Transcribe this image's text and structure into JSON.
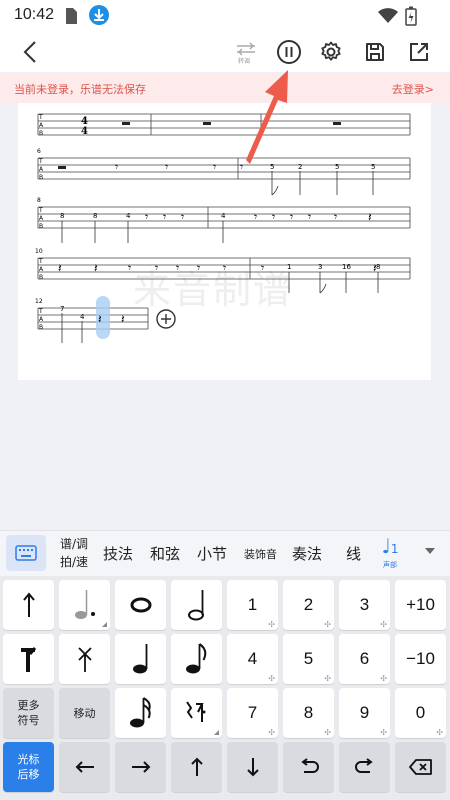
{
  "status": {
    "time": "10:42"
  },
  "toolbar": {
    "tune_label": "转调",
    "icons": [
      "back-icon",
      "tune-icon",
      "pause-icon",
      "settings-icon",
      "save-icon",
      "share-icon"
    ]
  },
  "banner": {
    "message": "当前未登录，乐谱无法保存",
    "login": "去登录>"
  },
  "score": {
    "watermark": "来音制谱",
    "systems": [
      {
        "measure_no": "",
        "frets": []
      },
      {
        "measure_no": "6",
        "frets": [
          "5",
          "2",
          "5",
          "5"
        ]
      },
      {
        "measure_no": "8",
        "frets": [
          "8",
          "8",
          "4",
          "4"
        ]
      },
      {
        "measure_no": "10",
        "frets": [
          "1",
          "3",
          "16",
          "8"
        ]
      },
      {
        "measure_no": "12",
        "frets": [
          "7",
          "4"
        ]
      }
    ],
    "time_signature": {
      "top": "4",
      "bottom": "4"
    },
    "tab_label": [
      "T",
      "A",
      "B"
    ]
  },
  "categories": {
    "stack_top": "谱/调",
    "stack_bottom": "拍/速",
    "items": [
      "技法",
      "和弦",
      "小节",
      "装饰音",
      "奏法",
      "线"
    ],
    "voice_label": "声部",
    "voice_number": "1"
  },
  "keypad": {
    "more_symbols": [
      "更多",
      "符号"
    ],
    "move": "移动",
    "cursor_back": [
      "光标",
      "后移"
    ],
    "numbers": [
      "1",
      "2",
      "3",
      "4",
      "5",
      "6",
      "7",
      "8",
      "9",
      "0"
    ],
    "plus10": "+10",
    "minus10": "−10"
  },
  "colors": {
    "accent": "#2a7fe8",
    "banner_text": "#e0544b",
    "arrow": "#ec5b4c"
  }
}
